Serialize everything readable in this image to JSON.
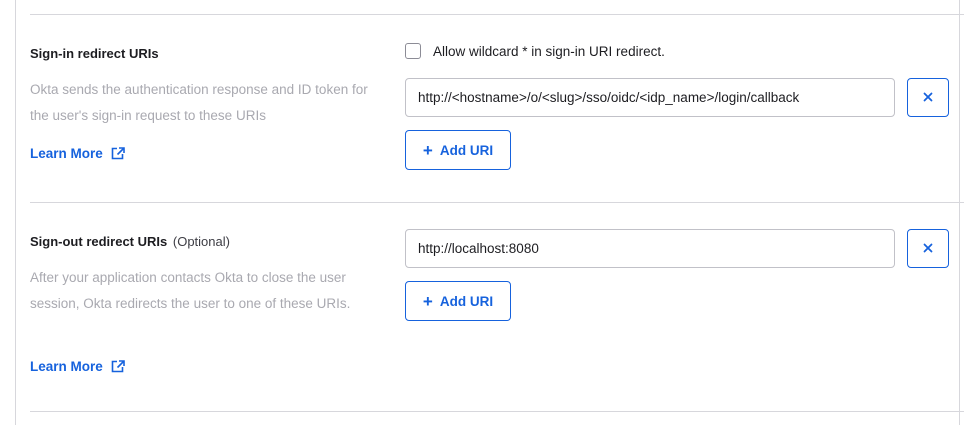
{
  "signin": {
    "title": "Sign-in redirect URIs",
    "description": "Okta sends the authentication response and ID token for the user's sign-in request to these URIs",
    "learn_more": "Learn More",
    "wildcard_label": "Allow wildcard * in sign-in URI redirect.",
    "wildcard_checked": false,
    "uris": [
      "http://<hostname>/o/<slug>/sso/oidc/<idp_name>/login/callback"
    ],
    "add_label": "Add URI"
  },
  "signout": {
    "title": "Sign-out redirect URIs",
    "optional": "(Optional)",
    "description": "After your application contacts Okta to close the user session, Okta redirects the user to one of these URIs.",
    "learn_more": "Learn More",
    "uris": [
      "http://localhost:8080"
    ],
    "add_label": "Add URI"
  },
  "colors": {
    "accent": "#1662dd",
    "muted_text": "#a9a9b0",
    "border": "#d7d7dc"
  },
  "icons": {
    "external_link": "external-link-icon",
    "remove": "close-icon",
    "add": "plus-icon"
  }
}
